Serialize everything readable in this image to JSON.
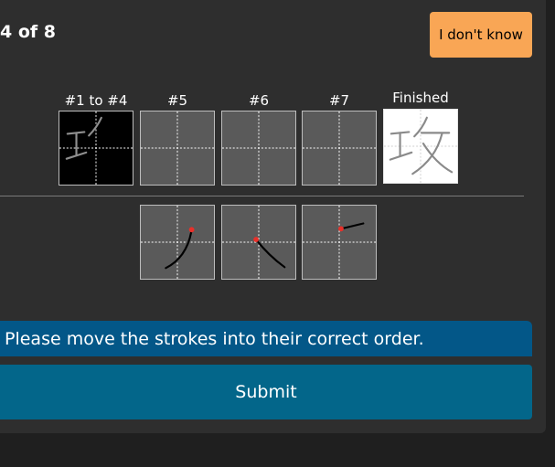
{
  "header": {
    "progress": "4 of 8",
    "dont_know_label": "I don't know"
  },
  "target_slots": [
    {
      "label": "#1 to #4",
      "state": "drawn"
    },
    {
      "label": "#5",
      "state": "empty"
    },
    {
      "label": "#6",
      "state": "empty"
    },
    {
      "label": "#7",
      "state": "empty"
    },
    {
      "label": "Finished",
      "state": "complete"
    }
  ],
  "finished_character": "攻",
  "candidate_strokes": [
    {
      "description": "stroke curving down-left"
    },
    {
      "description": "stroke falling down-right"
    },
    {
      "description": "short rising stroke"
    }
  ],
  "instruction": "Please move the strokes into their correct order.",
  "submit_label": "Submit",
  "colors": {
    "panel": "#2e2e2e",
    "dont_know_button": "#f9a655",
    "instruction_bar": "#035788",
    "submit_bar": "#03668a",
    "stroke_start_marker": "#e8302a"
  }
}
